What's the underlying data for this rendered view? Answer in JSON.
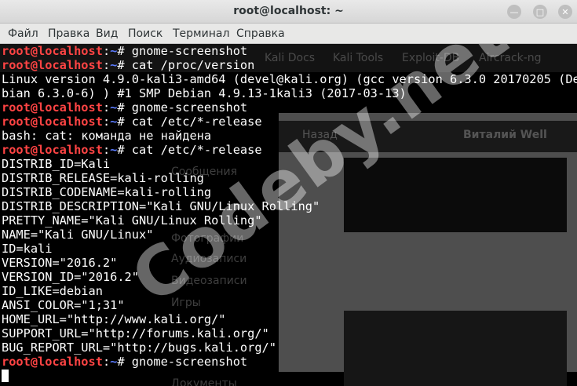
{
  "window": {
    "title": "root@localhost: ~",
    "minimize_icon": "minimize-icon",
    "maximize_icon": "maximize-icon",
    "close_icon": "close-icon"
  },
  "menu": [
    "Файл",
    "Правка",
    "Вид",
    "Поиск",
    "Терминал",
    "Справка"
  ],
  "background_ghost": {
    "tabs": [
      "Kali Docs",
      "Kali Tools",
      "Exploit-DB",
      "Aircrack-ng"
    ],
    "back_label": "Назад",
    "profile_name": "Виталий Well",
    "sidebar": [
      "Сообщения",
      "Фотографии",
      "Аудиозаписи",
      "Видеозаписи",
      "Игры",
      "Документы"
    ]
  },
  "watermark": "Codeby.net",
  "terminal": {
    "prompt_user": "root@localhost",
    "prompt_path": "~",
    "lines": [
      {
        "type": "cmd",
        "text": "gnome-screenshot"
      },
      {
        "type": "cmd",
        "text": "cat /proc/version"
      },
      {
        "type": "out",
        "text": "Linux version 4.9.0-kali3-amd64 (devel@kali.org) (gcc version 6.3.0 20170205 (De"
      },
      {
        "type": "out",
        "text": "bian 6.3.0-6) ) #1 SMP Debian 4.9.13-1kali3 (2017-03-13)"
      },
      {
        "type": "cmd",
        "text": "gnome-screenshot"
      },
      {
        "type": "cmd",
        "text": "cat /etc/*-release"
      },
      {
        "type": "out",
        "text": "bash: cat: команда не найдена"
      },
      {
        "type": "cmd",
        "text": "cat /etc/*-release"
      },
      {
        "type": "out",
        "text": "DISTRIB_ID=Kali"
      },
      {
        "type": "out",
        "text": "DISTRIB_RELEASE=kali-rolling"
      },
      {
        "type": "out",
        "text": "DISTRIB_CODENAME=kali-rolling"
      },
      {
        "type": "out",
        "text": "DISTRIB_DESCRIPTION=\"Kali GNU/Linux Rolling\""
      },
      {
        "type": "out",
        "text": "PRETTY_NAME=\"Kali GNU/Linux Rolling\""
      },
      {
        "type": "out",
        "text": "NAME=\"Kali GNU/Linux\""
      },
      {
        "type": "out",
        "text": "ID=kali"
      },
      {
        "type": "out",
        "text": "VERSION=\"2016.2\""
      },
      {
        "type": "out",
        "text": "VERSION_ID=\"2016.2\""
      },
      {
        "type": "out",
        "text": "ID_LIKE=debian"
      },
      {
        "type": "out",
        "text": "ANSI_COLOR=\"1;31\""
      },
      {
        "type": "out",
        "text": "HOME_URL=\"http://www.kali.org/\""
      },
      {
        "type": "out",
        "text": "SUPPORT_URL=\"http://forums.kali.org/\""
      },
      {
        "type": "out",
        "text": "BUG_REPORT_URL=\"http://bugs.kali.org/\""
      },
      {
        "type": "cmd",
        "text": "gnome-screenshot"
      },
      {
        "type": "cursor",
        "text": ""
      }
    ]
  }
}
